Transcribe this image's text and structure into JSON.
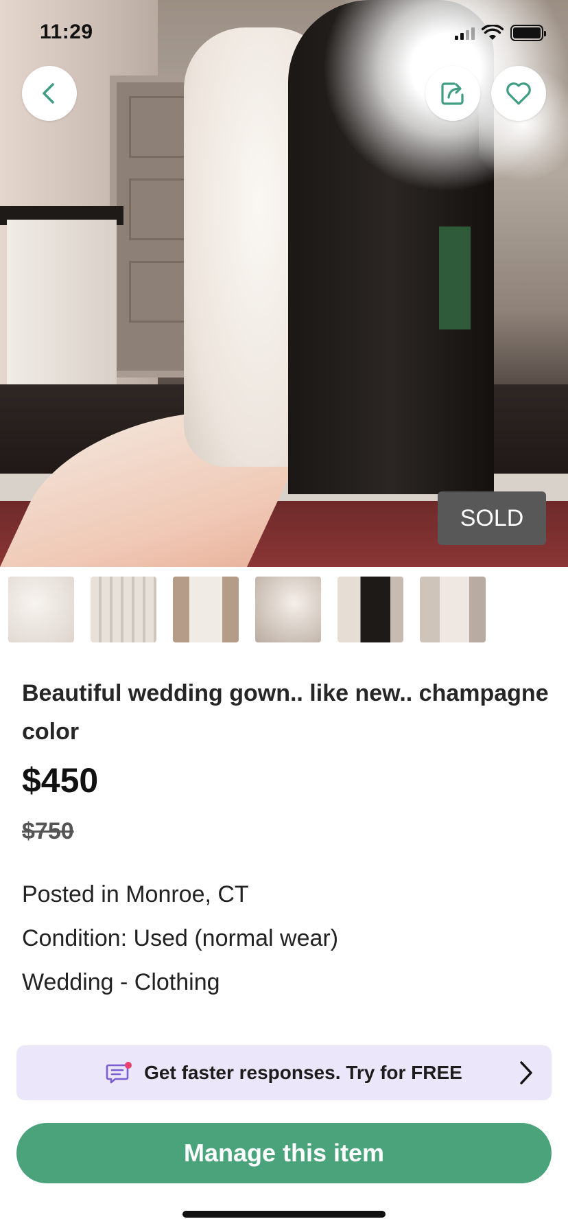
{
  "status_bar": {
    "time": "11:29"
  },
  "listing": {
    "badge": "SOLD",
    "title": "Beautiful wedding gown.. like new.. champagne color",
    "price": "$450",
    "original_price": "$750",
    "location": "Posted in Monroe, CT",
    "condition": "Condition: Used (normal wear)",
    "category": "Wedding - Clothing"
  },
  "promo": {
    "text": "Get faster responses. Try for FREE"
  },
  "actions": {
    "manage_label": "Manage this item"
  },
  "colors": {
    "accent": "#4aa37b",
    "icon_accent": "#3f9d80",
    "promo_bg": "#ebe6fa",
    "badge_bg": "#585858"
  },
  "icons": [
    "back-chevron-icon",
    "share-icon",
    "heart-icon",
    "message-icon",
    "chevron-right-icon"
  ]
}
